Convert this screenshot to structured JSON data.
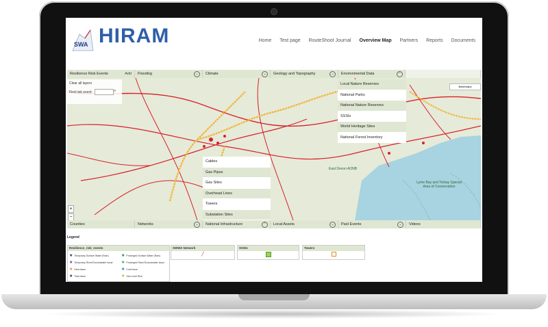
{
  "header": {
    "logo_small": "SWA",
    "logo_title": "HIRAM"
  },
  "nav": [
    "Home",
    "Test page",
    "RouteShoot Journal",
    "Overview Map",
    "Partners",
    "Reports",
    "Documents"
  ],
  "nav_active": "Overview Map",
  "layer_tabs_top": [
    {
      "label": "Resilience Risk Events",
      "extra": "Add"
    },
    {
      "label": "Flooding"
    },
    {
      "label": "Climate"
    },
    {
      "label": "Geology and Topography"
    },
    {
      "label": "Environmental Data"
    }
  ],
  "map_panel": {
    "clear_all": "Clear all layers",
    "find_label": "Find risk event:",
    "basemap_label": "Basemaps"
  },
  "environmental_menu": [
    "Local Nature Reserves",
    "National Parks",
    "National Nature Reserves",
    "SSSIs",
    "World Heritage Sites",
    "National Forest Inventory"
  ],
  "infrastructure_menu": [
    "Cables",
    "Gas Pipes",
    "Gas Sites",
    "Overhead Lines",
    "Towers",
    "Substation Sites"
  ],
  "map_labels": {
    "devon": "East Devon AONB",
    "bay": "Lyme Bay and Torbay Special Area of Conservation"
  },
  "layer_tabs_bottom": [
    {
      "label": "Counties"
    },
    {
      "label": "Networks"
    },
    {
      "label": "National Infrastructure"
    },
    {
      "label": "Local Assets"
    },
    {
      "label": "Past Events"
    },
    {
      "label": "Videos"
    }
  ],
  "legend": {
    "title": "Legend",
    "risk_box_title": "Resilience_risk_events",
    "risk_items": [
      {
        "label": "Temporary Surface Water (Rain)",
        "color": "#1f2a66"
      },
      {
        "label": "Prolonged Surface Water (Rain)",
        "color": "#1d7a2e"
      },
      {
        "label": "Temporary River/Groundwater Issue",
        "color": "#7a2aa0"
      },
      {
        "label": "Prolonged River/Groundwater Issue",
        "color": "#2fa04a"
      },
      {
        "label": "Heat Issue",
        "color": "#d98a1e"
      },
      {
        "label": "Cold Issue",
        "color": "#2a66c9"
      },
      {
        "label": "Tidal Issue",
        "color": "#1f2a66"
      },
      {
        "label": "Sea Level Rise",
        "color": "#c9b11e"
      }
    ],
    "boxes": [
      {
        "title": "SWWA Network"
      },
      {
        "title": "SSSIs"
      },
      {
        "title": "Towers"
      }
    ]
  },
  "colors": {
    "tab_bg": "#dfe7d3",
    "road": "#d8202a",
    "sea": "#a8d3e0",
    "logo_blue": "#2f5fa8"
  }
}
